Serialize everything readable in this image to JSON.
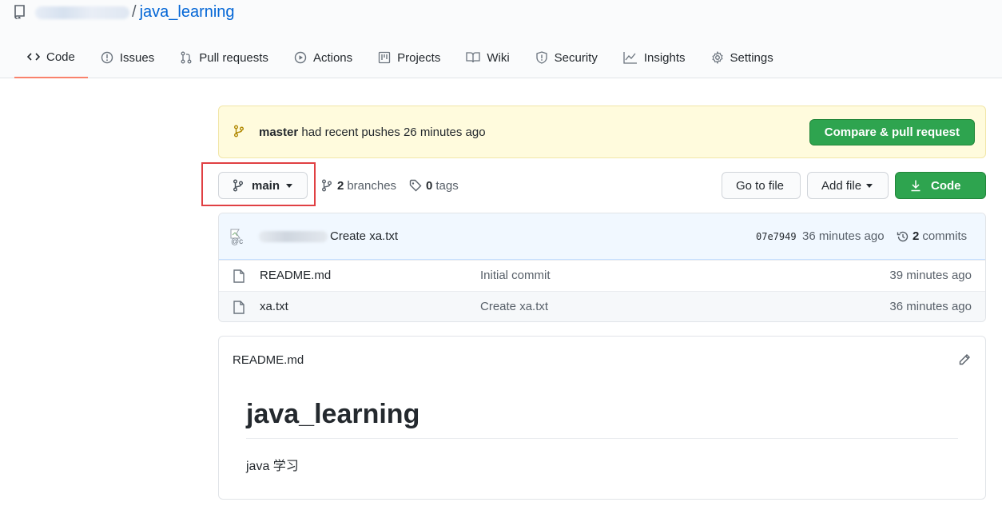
{
  "repo": {
    "name": "java_learning",
    "separator": "/"
  },
  "nav": {
    "tabs": [
      {
        "label": "Code",
        "icon": "code-icon",
        "active": true
      },
      {
        "label": "Issues",
        "icon": "issue-icon"
      },
      {
        "label": "Pull requests",
        "icon": "pull-request-icon"
      },
      {
        "label": "Actions",
        "icon": "play-icon"
      },
      {
        "label": "Projects",
        "icon": "project-icon"
      },
      {
        "label": "Wiki",
        "icon": "book-icon"
      },
      {
        "label": "Security",
        "icon": "shield-icon"
      },
      {
        "label": "Insights",
        "icon": "graph-icon"
      },
      {
        "label": "Settings",
        "icon": "gear-icon"
      }
    ]
  },
  "banner": {
    "branch": "master",
    "text": "had recent pushes 26 minutes ago",
    "button": "Compare & pull request"
  },
  "toolbar": {
    "branch_button": "main",
    "branches_count": "2",
    "branches_label": "branches",
    "tags_count": "0",
    "tags_label": "tags",
    "go_to_file": "Go to file",
    "add_file": "Add file",
    "code_button": "Code"
  },
  "latest_commit": {
    "avatar_alt": "@c",
    "message": "Create xa.txt",
    "sha": "07e7949",
    "time": "36 minutes ago",
    "commits_count": "2",
    "commits_label": "commits"
  },
  "files": [
    {
      "name": "README.md",
      "message": "Initial commit",
      "age": "39 minutes ago"
    },
    {
      "name": "xa.txt",
      "message": "Create xa.txt",
      "age": "36 minutes ago"
    }
  ],
  "readme": {
    "filename": "README.md",
    "heading": "java_learning",
    "body": "java 学习"
  },
  "colors": {
    "accent_link": "#0366d6",
    "green": "#2ea44f",
    "active_tab_underline": "#f9826c",
    "highlight_box": "#e04043",
    "banner_bg": "#fffbdd"
  }
}
